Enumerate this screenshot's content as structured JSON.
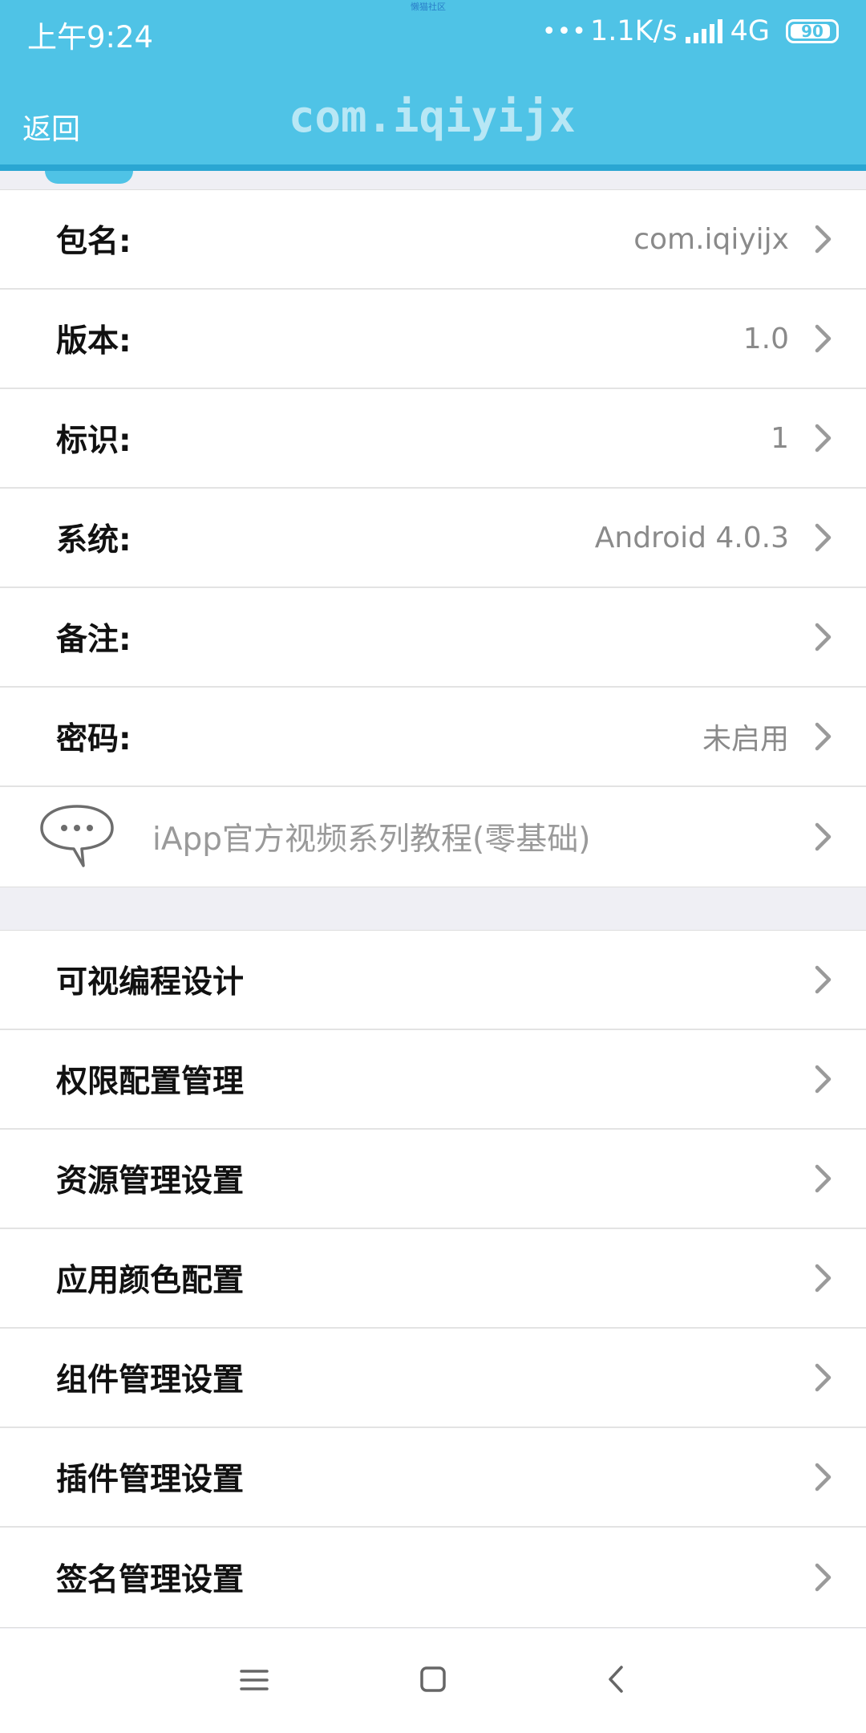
{
  "status_bar": {
    "time": "上午9:24",
    "center_tiny": "懒猫社区",
    "net_speed": "1.1K/s",
    "network": "4G",
    "battery": "90",
    "battery_level": 0.9
  },
  "app_bar": {
    "back_label": "返回",
    "title": "com.iqiyijx",
    "accent_color": "#4fc3e6"
  },
  "info_rows": [
    {
      "label": "包名:",
      "value": "com.iqiyijx"
    },
    {
      "label": "版本:",
      "value": "1.0"
    },
    {
      "label": "标识:",
      "value": "1"
    },
    {
      "label": "系统:",
      "value": "Android 4.0.3"
    },
    {
      "label": "备注:",
      "value": ""
    },
    {
      "label": "密码:",
      "value": "未启用"
    }
  ],
  "promo": {
    "icon": "chat-bubble-icon",
    "text": "iApp官方视频系列教程(零基础)"
  },
  "settings_rows": [
    "可视编程设计",
    "权限配置管理",
    "资源管理设置",
    "应用颜色配置",
    "组件管理设置",
    "插件管理设置",
    "签名管理设置"
  ],
  "nav_bar": {
    "icons": [
      "menu-icon",
      "home-icon",
      "back-icon"
    ]
  }
}
